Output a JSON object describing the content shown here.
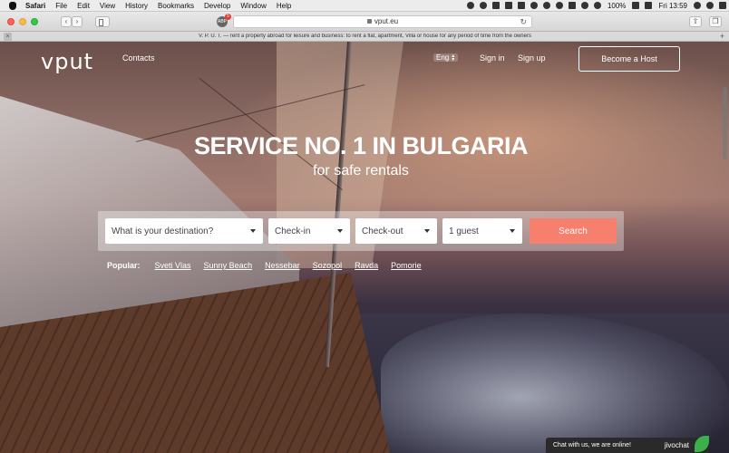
{
  "menubar": {
    "app": "Safari",
    "items": [
      "File",
      "Edit",
      "View",
      "History",
      "Bookmarks",
      "Develop",
      "Window",
      "Help"
    ],
    "battery": "100%",
    "clock": "Fri 13:59"
  },
  "toolbar": {
    "url": "vput.eu",
    "ext_badge": "5"
  },
  "tab": {
    "title": "V. P. U. T. — rent a property abroad for leisure and business: to rent a flat, apartment, Villa or house for any period of time from the owners"
  },
  "site": {
    "logo": "vput",
    "nav": {
      "contacts": "Contacts",
      "lang": "Eng",
      "signin": "Sign in",
      "signup": "Sign up",
      "host": "Become a Host"
    },
    "hero": {
      "title": "SERVICE NO. 1 IN BULGARIA",
      "subtitle": "for safe rentals"
    },
    "search": {
      "destination": "What is your destination?",
      "checkin": "Check-in",
      "checkout": "Check-out",
      "guests": "1 guest",
      "button": "Search"
    },
    "popular": {
      "label": "Popular:",
      "links": [
        "Sveti Vlas",
        "Sunny Beach",
        "Nessebar",
        "Sozopol",
        "Ravda",
        "Pomorie"
      ]
    },
    "chat": {
      "text": "Chat with us, we are online!",
      "brand": "jivochat"
    }
  },
  "colors": {
    "accent": "#f77f6e",
    "chat_green": "#3ab14a"
  }
}
